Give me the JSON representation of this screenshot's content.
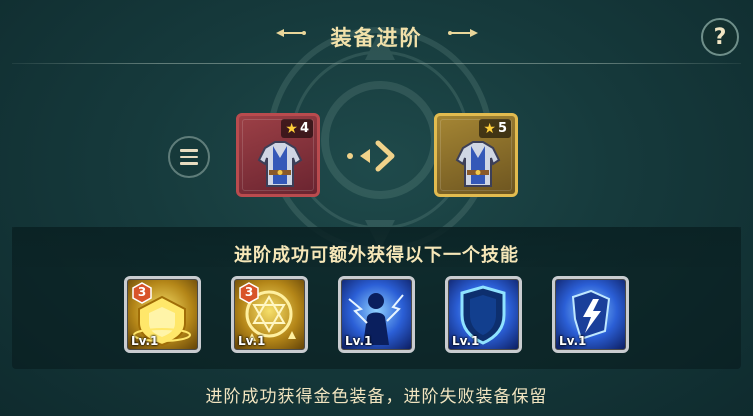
{
  "header": {
    "title": "装备进阶",
    "help_label": "?"
  },
  "upgrade": {
    "menu_icon": "list-icon",
    "current_item": {
      "stars": "4",
      "icon": "armor-icon",
      "frame_color": "#b94b4e"
    },
    "arrow_icon": "arrow-right-icon",
    "next_item": {
      "stars": "5",
      "icon": "armor-icon",
      "frame_color": "#e2bb4f"
    }
  },
  "skills_panel": {
    "title": "进阶成功可额外获得以下一个技能",
    "skills": [
      {
        "level": "Lv.1",
        "badge": "3",
        "icon": "golden-shield-icon"
      },
      {
        "level": "Lv.1",
        "badge": "3",
        "icon": "golden-emblem-icon"
      },
      {
        "level": "Lv.1",
        "badge": "",
        "icon": "lightning-figure-icon"
      },
      {
        "level": "Lv.1",
        "badge": "",
        "icon": "blue-shield-icon"
      },
      {
        "level": "Lv.1",
        "badge": "",
        "icon": "lightning-armor-icon"
      }
    ]
  },
  "footer_note": "进阶成功获得金色装备，进阶失败装备保留"
}
